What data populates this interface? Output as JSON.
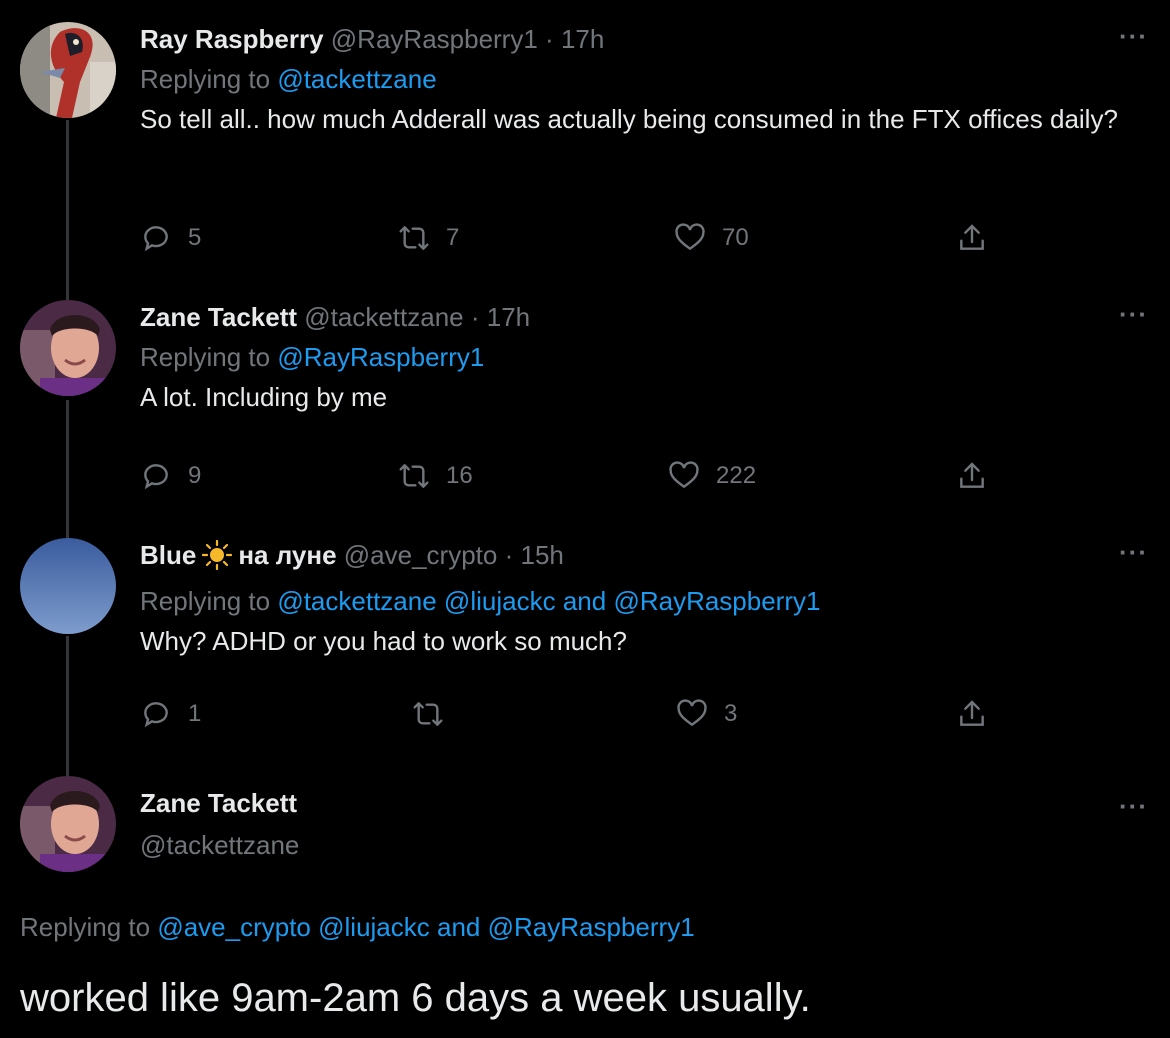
{
  "tweets": [
    {
      "name": "Ray Raspberry",
      "handle": "@RayRaspberry1",
      "dot": "·",
      "time": "17h",
      "replying_prefix": "Replying to",
      "mentions": [
        "@tackettzane"
      ],
      "text": "So tell all.. how much Adderall was actually being consumed in the FTX offices daily?",
      "replies": "5",
      "retweets": "7",
      "likes": "70",
      "avatar_color": "#b7a89a"
    },
    {
      "name": "Zane Tackett",
      "handle": "@tackettzane",
      "dot": "·",
      "time": "17h",
      "replying_prefix": "Replying to",
      "mentions": [
        "@RayRaspberry1"
      ],
      "text": "A lot. Including by me",
      "replies": "9",
      "retweets": "16",
      "likes": "222",
      "avatar_color": "#6a3b5e"
    },
    {
      "name_part1": "Blue",
      "name_part2": "на луне",
      "handle": "@ave_crypto",
      "dot": "·",
      "time": "15h",
      "replying_prefix": "Replying to",
      "mentions": [
        "@tackettzane",
        "@liujackc",
        "and",
        "@RayRaspberry1"
      ],
      "text": "Why? ADHD or you had to work so much?",
      "replies": "1",
      "retweets": "",
      "likes": "3",
      "avatar_color": "#5b7fbf"
    }
  ],
  "main_tweet": {
    "name": "Zane Tackett",
    "handle": "@tackettzane",
    "replying_prefix": "Replying to",
    "mentions": [
      "@ave_crypto",
      "@liujackc",
      "and",
      "@RayRaspberry1"
    ],
    "text": "worked like 9am-2am 6 days a week usually."
  },
  "more_label": "···",
  "colors": {
    "background": "#000000",
    "text": "#e7e9ea",
    "muted": "#71767b",
    "link": "#1d9bf0",
    "thread_line": "#333639"
  },
  "icons": [
    "reply-icon",
    "retweet-icon",
    "like-icon",
    "share-icon",
    "more-icon",
    "sun-emoji"
  ]
}
